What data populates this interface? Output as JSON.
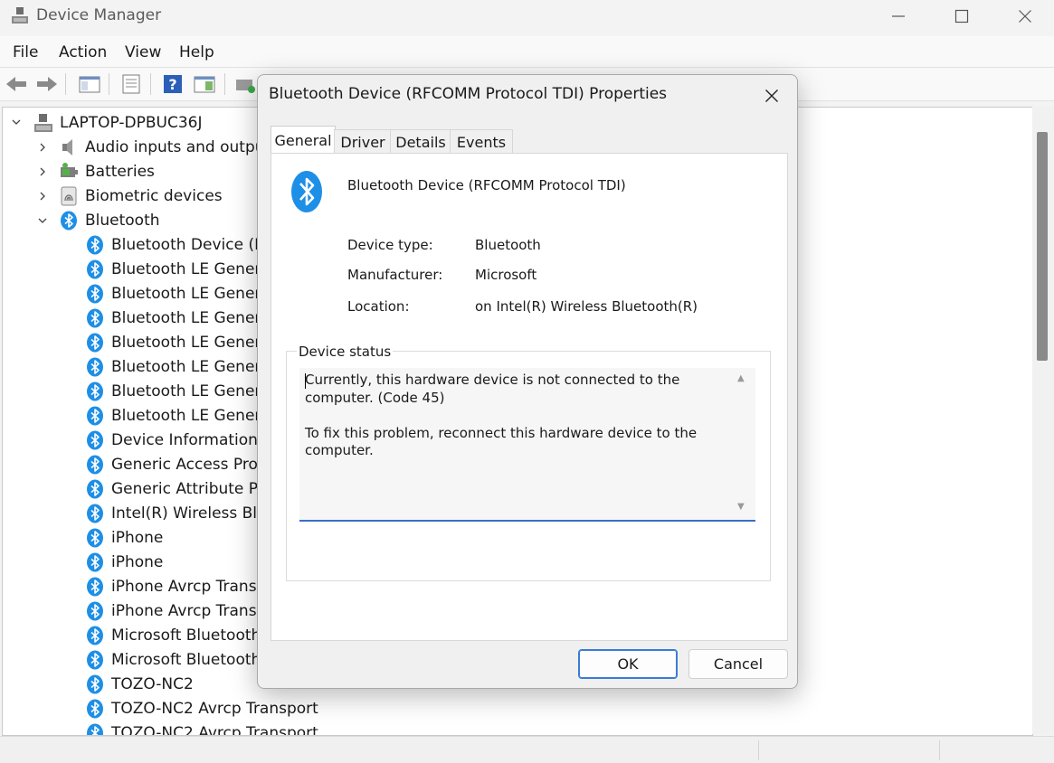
{
  "window": {
    "title": "Device Manager"
  },
  "menu": [
    "File",
    "Action",
    "View",
    "Help"
  ],
  "tree": {
    "root": "LAPTOP-DPBUC36J",
    "categories": [
      "Audio inputs and outputs",
      "Batteries",
      "Biometric devices",
      "Bluetooth"
    ],
    "bluetooth_items": [
      "Bluetooth Device (RFCOMM Protocol TDI)",
      "Bluetooth LE Generic Attribute Service",
      "Bluetooth LE Generic Attribute Service",
      "Bluetooth LE Generic Attribute Service",
      "Bluetooth LE Generic Attribute Service",
      "Bluetooth LE Generic Attribute Service",
      "Bluetooth LE Generic Attribute Service",
      "Bluetooth LE Generic Attribute Service",
      "Device Information Service",
      "Generic Access Profile",
      "Generic Attribute Profile",
      "Intel(R) Wireless Bluetooth(R)",
      "iPhone",
      "iPhone",
      "iPhone Avrcp Transport",
      "iPhone Avrcp Transport",
      "Microsoft Bluetooth Enumerator",
      "Microsoft Bluetooth LE Enumerator",
      "TOZO-NC2",
      "TOZO-NC2 Avrcp Transport",
      "TOZO-NC2 Avrcp Transport"
    ]
  },
  "dialog": {
    "title": "Bluetooth Device (RFCOMM Protocol TDI) Properties",
    "tabs": [
      "General",
      "Driver",
      "Details",
      "Events"
    ],
    "device_name": "Bluetooth Device (RFCOMM Protocol TDI)",
    "props": {
      "type_label": "Device type:",
      "type_value": "Bluetooth",
      "mfr_label": "Manufacturer:",
      "mfr_value": "Microsoft",
      "loc_label": "Location:",
      "loc_value": "on Intel(R) Wireless Bluetooth(R)"
    },
    "status_title": "Device status",
    "status_text": "Currently, this hardware device is not connected to the computer. (Code 45)\n\nTo fix this problem, reconnect this hardware device to the computer.",
    "ok": "OK",
    "cancel": "Cancel"
  },
  "colors": {
    "bluetooth": "#1e8fe6",
    "accent": "#3a7bd5"
  }
}
